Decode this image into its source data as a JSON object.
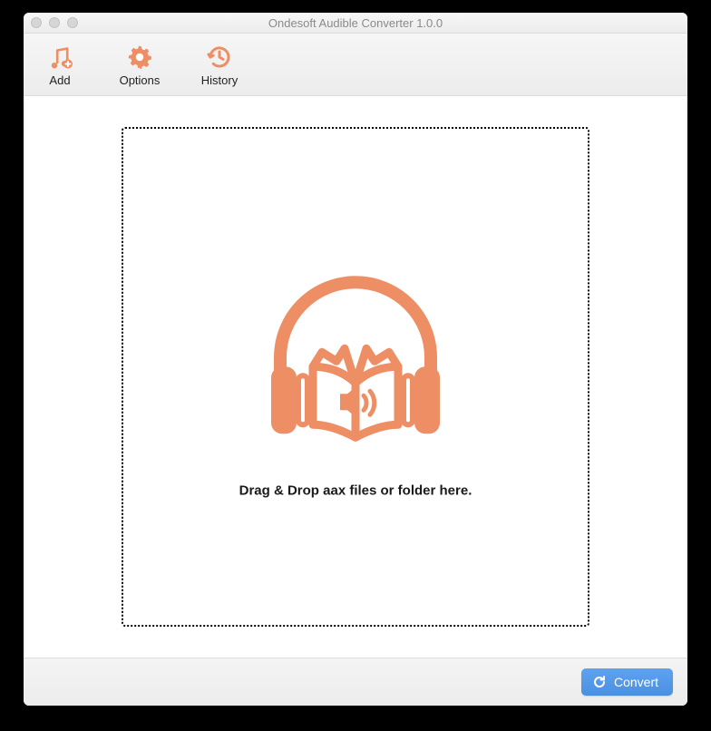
{
  "window": {
    "title": "Ondesoft Audible Converter 1.0.0"
  },
  "toolbar": {
    "add": {
      "label": "Add",
      "icon": "add-music-icon"
    },
    "options": {
      "label": "Options",
      "icon": "gear-icon"
    },
    "history": {
      "label": "History",
      "icon": "history-icon"
    }
  },
  "dropzone": {
    "illustration": "audiobook-headphones-icon",
    "text": "Drag & Drop aax files or folder here."
  },
  "footer": {
    "convert": {
      "label": "Convert",
      "icon": "convert-icon"
    }
  },
  "colors": {
    "accent": "#ed8e64",
    "primary_button": "#4a90e2"
  }
}
